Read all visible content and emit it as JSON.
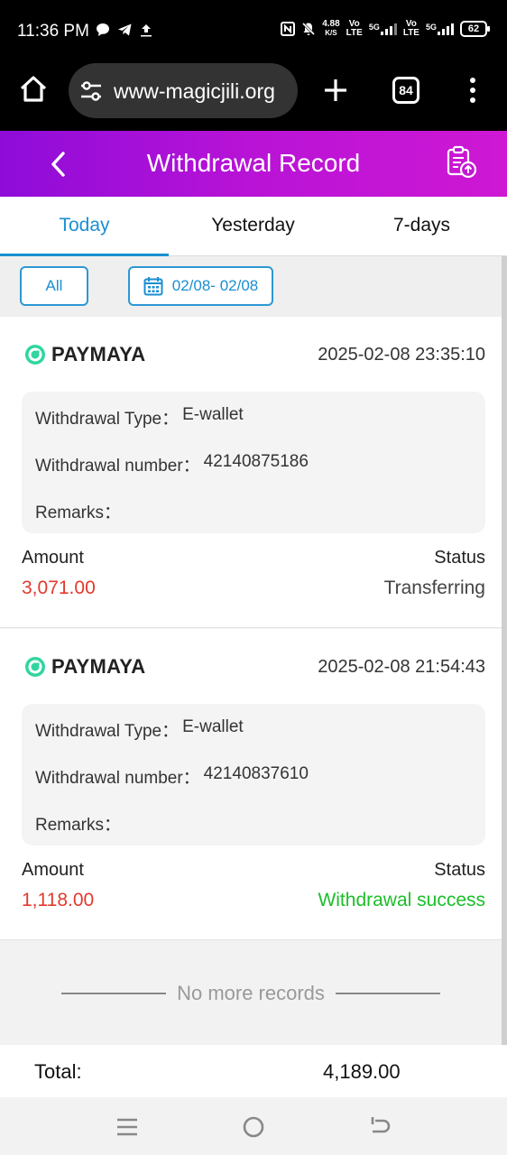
{
  "status_bar": {
    "time": "11:36 PM",
    "net_speed_value": "4.88",
    "net_speed_unit": "K/S",
    "sim1_label_top": "Vo",
    "sim1_label_bottom": "LTE",
    "sim1_gen": "5G",
    "sim2_label_top": "Vo",
    "sim2_label_bottom": "LTE",
    "sim2_gen": "5G",
    "battery": "62"
  },
  "browser": {
    "url": "www-magicjili.org",
    "tab_count": "84"
  },
  "header": {
    "title": "Withdrawal Record"
  },
  "tabs": [
    {
      "label": "Today",
      "active": true
    },
    {
      "label": "Yesterday",
      "active": false
    },
    {
      "label": "7-days",
      "active": false
    }
  ],
  "filter": {
    "all_label": "All",
    "date_range": "02/08- 02/08"
  },
  "records": [
    {
      "provider": "PAYMAYA",
      "datetime": "2025-02-08 23:35:10",
      "type_label": "Withdrawal Type：",
      "type_value": "E-wallet",
      "number_label": "Withdrawal number：",
      "number_value": "42140875186",
      "remarks_label": "Remarks：",
      "amount_label": "Amount",
      "amount_value": "3,071.00",
      "status_label": "Status",
      "status_value": "Transferring",
      "status_color": "#444444"
    },
    {
      "provider": "PAYMAYA",
      "datetime": "2025-02-08 21:54:43",
      "type_label": "Withdrawal Type：",
      "type_value": "E-wallet",
      "number_label": "Withdrawal number：",
      "number_value": "42140837610",
      "remarks_label": "Remarks：",
      "amount_label": "Amount",
      "amount_value": "1,118.00",
      "status_label": "Status",
      "status_value": "Withdrawal success",
      "status_color": "#1bbf2a"
    }
  ],
  "no_more_text": "No more records",
  "total": {
    "label": "Total:",
    "value": "4,189.00"
  },
  "colors": {
    "accent": "#1a8fd1",
    "header_gradient_start": "#8e0cd9",
    "header_gradient_end": "#ce18d4",
    "amount": "#e23a2c",
    "paymaya_green": "#2fd6a0"
  }
}
